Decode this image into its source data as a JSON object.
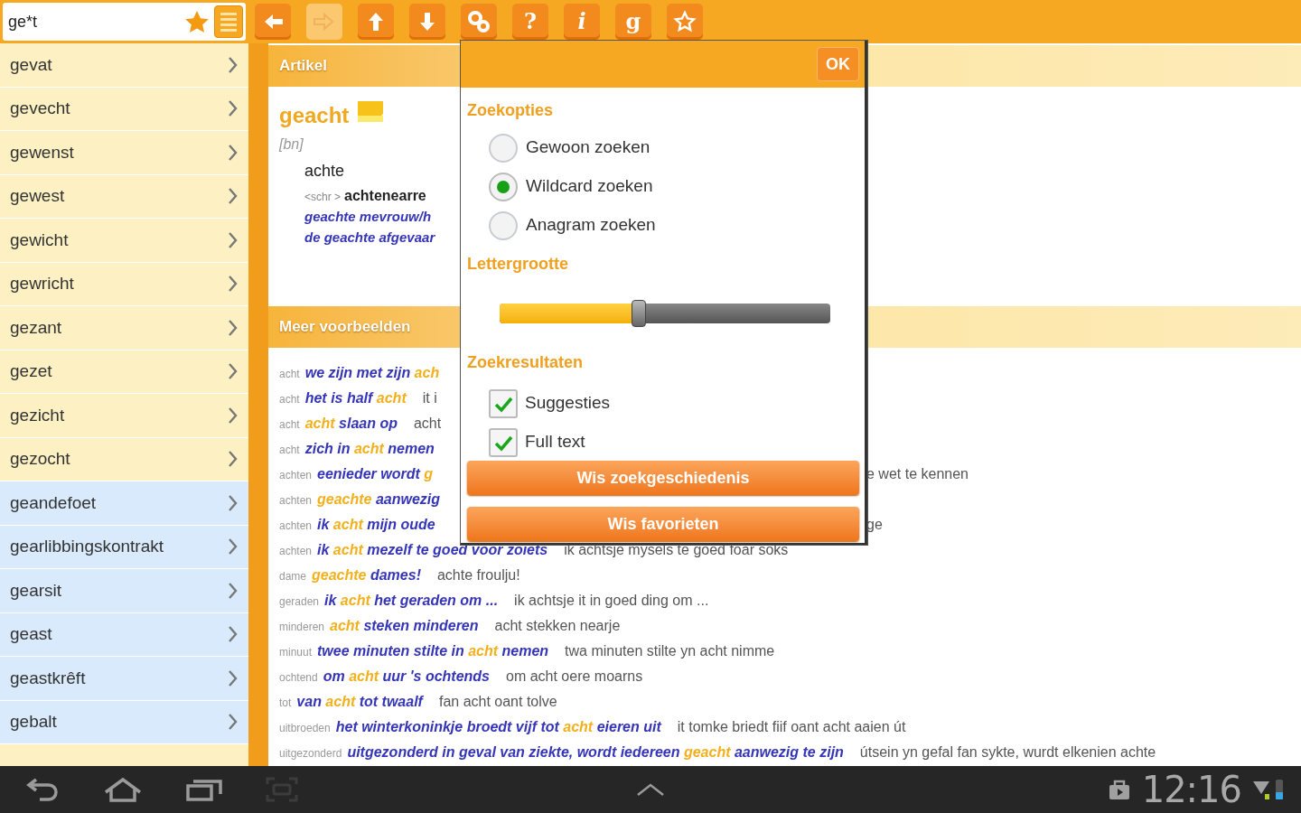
{
  "search": {
    "value": "ge*t"
  },
  "toolbar": [
    {
      "kind": "back",
      "disabled": false
    },
    {
      "kind": "forward",
      "disabled": true
    },
    {
      "kind": "up",
      "disabled": false
    },
    {
      "kind": "down",
      "disabled": false
    },
    {
      "kind": "link",
      "disabled": false
    },
    {
      "kind": "text",
      "label": "?",
      "disabled": false
    },
    {
      "kind": "text",
      "label": "i",
      "italic": true,
      "disabled": false
    },
    {
      "kind": "text",
      "label": "g",
      "disabled": false
    },
    {
      "kind": "star",
      "disabled": false
    }
  ],
  "sidebar": {
    "items": [
      {
        "label": "gevat",
        "kind": "result"
      },
      {
        "label": "gevecht",
        "kind": "result"
      },
      {
        "label": "gewenst",
        "kind": "result"
      },
      {
        "label": "gewest",
        "kind": "result"
      },
      {
        "label": "gewicht",
        "kind": "result"
      },
      {
        "label": "gewricht",
        "kind": "result"
      },
      {
        "label": "gezant",
        "kind": "result"
      },
      {
        "label": "gezet",
        "kind": "result"
      },
      {
        "label": "gezicht",
        "kind": "result"
      },
      {
        "label": "gezocht",
        "kind": "result"
      },
      {
        "label": "geandefoet",
        "kind": "suggestion"
      },
      {
        "label": "gearlibbingskontrakt",
        "kind": "suggestion"
      },
      {
        "label": "gearsit",
        "kind": "suggestion"
      },
      {
        "label": "geast",
        "kind": "suggestion"
      },
      {
        "label": "geastkrêft",
        "kind": "suggestion"
      },
      {
        "label": "gebalt",
        "kind": "suggestion"
      }
    ]
  },
  "article": {
    "header": "Artikel",
    "headword": "geacht",
    "pos": "[bn]",
    "translation": "achte",
    "variant_label": "<schr >",
    "variant": "achtenearre",
    "examples": [
      "geachte mevrouw/h",
      "de geachte afgevaar"
    ]
  },
  "more_examples": {
    "header": "Meer voorbeelden",
    "rows": [
      {
        "lemma": "acht",
        "example": [
          {
            "text": "we zijn met zijn ",
            "highlight": false
          },
          {
            "text": "ach",
            "highlight": true
          }
        ],
        "covered": true
      },
      {
        "lemma": "acht",
        "example": [
          {
            "text": "het is half ",
            "highlight": false
          },
          {
            "text": "acht",
            "highlight": true
          }
        ],
        "translation": "it i",
        "covered": true
      },
      {
        "lemma": "acht",
        "example": [
          {
            "text": "acht",
            "highlight": true
          },
          {
            "text": " slaan op",
            "highlight": false
          }
        ],
        "translation": "acht",
        "covered": true
      },
      {
        "lemma": "acht",
        "example": [
          {
            "text": "zich in ",
            "highlight": false
          },
          {
            "text": "acht",
            "highlight": true
          },
          {
            "text": " nemen",
            "highlight": false
          }
        ],
        "covered": true
      },
      {
        "lemma": "achten",
        "example": [
          {
            "text": "eenieder wordt ",
            "highlight": false
          },
          {
            "text": "g",
            "highlight": true
          }
        ],
        "covered": true,
        "right": "e wet te kennen"
      },
      {
        "lemma": "achten",
        "example": [
          {
            "text": "geachte",
            "highlight": true
          },
          {
            "text": " aanwezig",
            "highlight": false
          }
        ],
        "covered": true
      },
      {
        "lemma": "achten",
        "example": [
          {
            "text": "ik ",
            "highlight": false
          },
          {
            "text": "acht",
            "highlight": true
          },
          {
            "text": " mijn oude",
            "highlight": false
          }
        ],
        "covered": true,
        "right": "ge"
      },
      {
        "lemma": "achten",
        "example": [
          {
            "text": "ik ",
            "highlight": false
          },
          {
            "text": "acht",
            "highlight": true
          },
          {
            "text": " mezelf te goed voor zoiets",
            "highlight": false
          }
        ],
        "translation": "ik achtsje mysels te goed foar soks",
        "covered": false
      },
      {
        "lemma": "dame",
        "example": [
          {
            "text": "geachte",
            "highlight": true
          },
          {
            "text": " dames!",
            "highlight": false
          }
        ],
        "translation": "achte froulju!",
        "covered": false
      },
      {
        "lemma": "geraden",
        "example": [
          {
            "text": "ik ",
            "highlight": false
          },
          {
            "text": "acht",
            "highlight": true
          },
          {
            "text": " het geraden om ...",
            "highlight": false
          }
        ],
        "translation": "ik achtsje it in goed ding om ...",
        "covered": false
      },
      {
        "lemma": "minderen",
        "example": [
          {
            "text": "acht",
            "highlight": true
          },
          {
            "text": " steken minderen",
            "highlight": false
          }
        ],
        "translation": "acht stekken nearje",
        "covered": false
      },
      {
        "lemma": "minuut",
        "example": [
          {
            "text": "twee minuten stilte in ",
            "highlight": false
          },
          {
            "text": "acht",
            "highlight": true
          },
          {
            "text": " nemen",
            "highlight": false
          }
        ],
        "translation": "twa minuten stilte yn acht nimme",
        "covered": false
      },
      {
        "lemma": "ochtend",
        "example": [
          {
            "text": "om ",
            "highlight": false
          },
          {
            "text": "acht",
            "highlight": true
          },
          {
            "text": " uur 's ochtends",
            "highlight": false
          }
        ],
        "translation": "om acht oere moarns",
        "covered": false
      },
      {
        "lemma": "tot",
        "example": [
          {
            "text": "van ",
            "highlight": false
          },
          {
            "text": "acht",
            "highlight": true
          },
          {
            "text": " tot twaalf",
            "highlight": false
          }
        ],
        "translation": "fan acht oant tolve",
        "covered": false
      },
      {
        "lemma": "uitbroeden",
        "example": [
          {
            "text": "het winterkoninkje broedt vijf tot ",
            "highlight": false
          },
          {
            "text": "acht",
            "highlight": true
          },
          {
            "text": " eieren uit",
            "highlight": false
          }
        ],
        "translation": "it tomke briedt fiif oant acht aaien út",
        "covered": false
      },
      {
        "lemma": "uitgezonderd",
        "example": [
          {
            "text": "uitgezonderd in geval van ziekte, wordt iedereen ",
            "highlight": false
          },
          {
            "text": "geacht",
            "highlight": true
          },
          {
            "text": " aanwezig te zijn",
            "highlight": false
          }
        ],
        "translation": "útsein yn gefal fan sykte, wurdt elkenien achte",
        "covered": false
      }
    ]
  },
  "dialog": {
    "ok": "OK",
    "search_options_title": "Zoekopties",
    "search_options": [
      {
        "label": "Gewoon zoeken",
        "selected": false
      },
      {
        "label": "Wildcard zoeken",
        "selected": true
      },
      {
        "label": "Anagram zoeken",
        "selected": false
      }
    ],
    "font_size_title": "Lettergrootte",
    "font_size": {
      "level": 0.42
    },
    "results_title": "Zoekresultaten",
    "results_options": [
      {
        "label": "Suggesties",
        "checked": true
      },
      {
        "label": "Full text",
        "checked": true
      }
    ],
    "buttons": [
      "Wis zoekgeschiedenis",
      "Wis favorieten"
    ]
  },
  "status_bar": {
    "time": "12:16"
  }
}
